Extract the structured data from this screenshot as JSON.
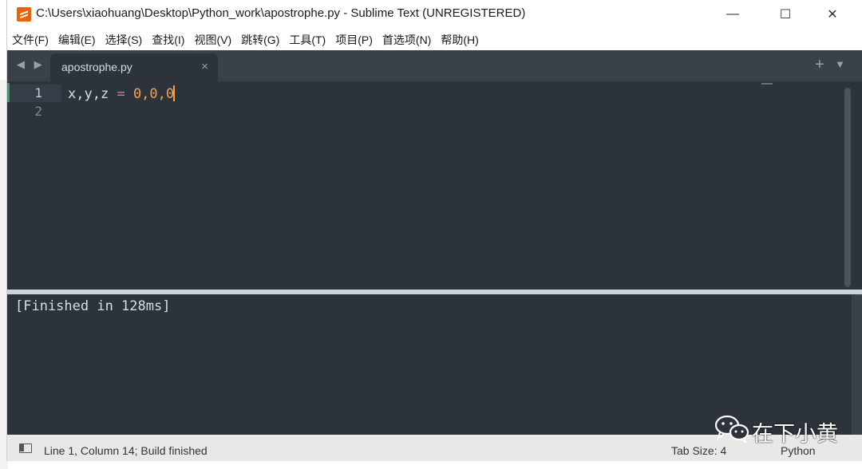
{
  "window": {
    "title": "C:\\Users\\xiaohuang\\Desktop\\Python_work\\apostrophe.py - Sublime Text (UNREGISTERED)",
    "controls": {
      "minimize": "—",
      "maximize": "☐",
      "close": "✕"
    }
  },
  "menu": [
    "文件(F)",
    "编辑(E)",
    "选择(S)",
    "查找(I)",
    "视图(V)",
    "跳转(G)",
    "工具(T)",
    "项目(P)",
    "首选项(N)",
    "帮助(H)"
  ],
  "tabs": {
    "nav": "◀ ▶",
    "active": {
      "label": "apostrophe.py",
      "close": "×"
    },
    "add": "+",
    "dropdown": "▼"
  },
  "editor": {
    "line_numbers": [
      "1",
      "2"
    ],
    "code_line1": {
      "vars": "x,y,z",
      "op": "=",
      "vals": "0,0,0"
    }
  },
  "output": {
    "text": "[Finished in 128ms]"
  },
  "statusbar": {
    "position": "Line 1, Column 14; Build finished",
    "tab_size": "Tab Size: 4",
    "syntax": "Python"
  },
  "watermark": {
    "text": "在下小黄",
    "icon": "wechat-icon"
  },
  "colors": {
    "editor_bg": "#2c333b",
    "tabbar_bg": "#3b4148",
    "number": "#f6a14a",
    "operator": "#f07178",
    "text": "#d8dee9"
  }
}
